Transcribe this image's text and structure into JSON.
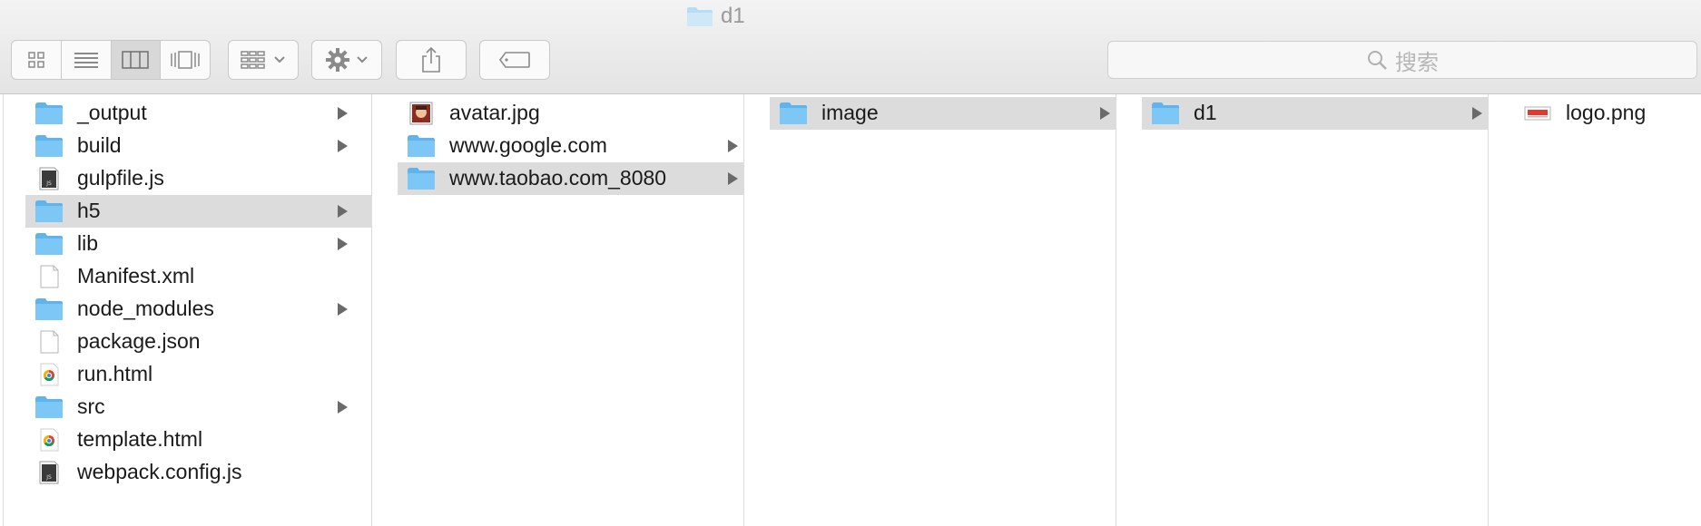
{
  "window": {
    "title": "d1"
  },
  "toolbar": {
    "view_modes": [
      "icon-view-icon",
      "list-view-icon",
      "column-view-icon",
      "cover-flow-view-icon"
    ],
    "active_view": 2,
    "search_placeholder": "搜索"
  },
  "columns": [
    {
      "items": [
        {
          "label": "_output",
          "type": "folder",
          "has_children": true,
          "selected": false
        },
        {
          "label": "build",
          "type": "folder",
          "has_children": true,
          "selected": false
        },
        {
          "label": "gulpfile.js",
          "type": "js",
          "has_children": false,
          "selected": false
        },
        {
          "label": "h5",
          "type": "folder",
          "has_children": true,
          "selected": true
        },
        {
          "label": "lib",
          "type": "folder",
          "has_children": true,
          "selected": false
        },
        {
          "label": "Manifest.xml",
          "type": "doc",
          "has_children": false,
          "selected": false
        },
        {
          "label": "node_modules",
          "type": "folder",
          "has_children": true,
          "selected": false
        },
        {
          "label": "package.json",
          "type": "doc",
          "has_children": false,
          "selected": false
        },
        {
          "label": "run.html",
          "type": "chrome",
          "has_children": false,
          "selected": false
        },
        {
          "label": "src",
          "type": "folder",
          "has_children": true,
          "selected": false
        },
        {
          "label": "template.html",
          "type": "chrome",
          "has_children": false,
          "selected": false
        },
        {
          "label": "webpack.config.js",
          "type": "js",
          "has_children": false,
          "selected": false
        }
      ]
    },
    {
      "items": [
        {
          "label": "avatar.jpg",
          "type": "image",
          "has_children": false,
          "selected": false
        },
        {
          "label": "www.google.com",
          "type": "folder",
          "has_children": true,
          "selected": false
        },
        {
          "label": "www.taobao.com_8080",
          "type": "folder",
          "has_children": true,
          "selected": true
        }
      ]
    },
    {
      "items": [
        {
          "label": "image",
          "type": "folder",
          "has_children": true,
          "selected": true
        }
      ]
    },
    {
      "items": [
        {
          "label": "d1",
          "type": "folder",
          "has_children": true,
          "selected": true
        }
      ]
    },
    {
      "items": [
        {
          "label": "logo.png",
          "type": "png",
          "has_children": false,
          "selected": false
        }
      ]
    }
  ],
  "colors": {
    "folder": "#7cc7f5",
    "selection": "#dcdcdc",
    "arrow": "#6a6a6a"
  }
}
